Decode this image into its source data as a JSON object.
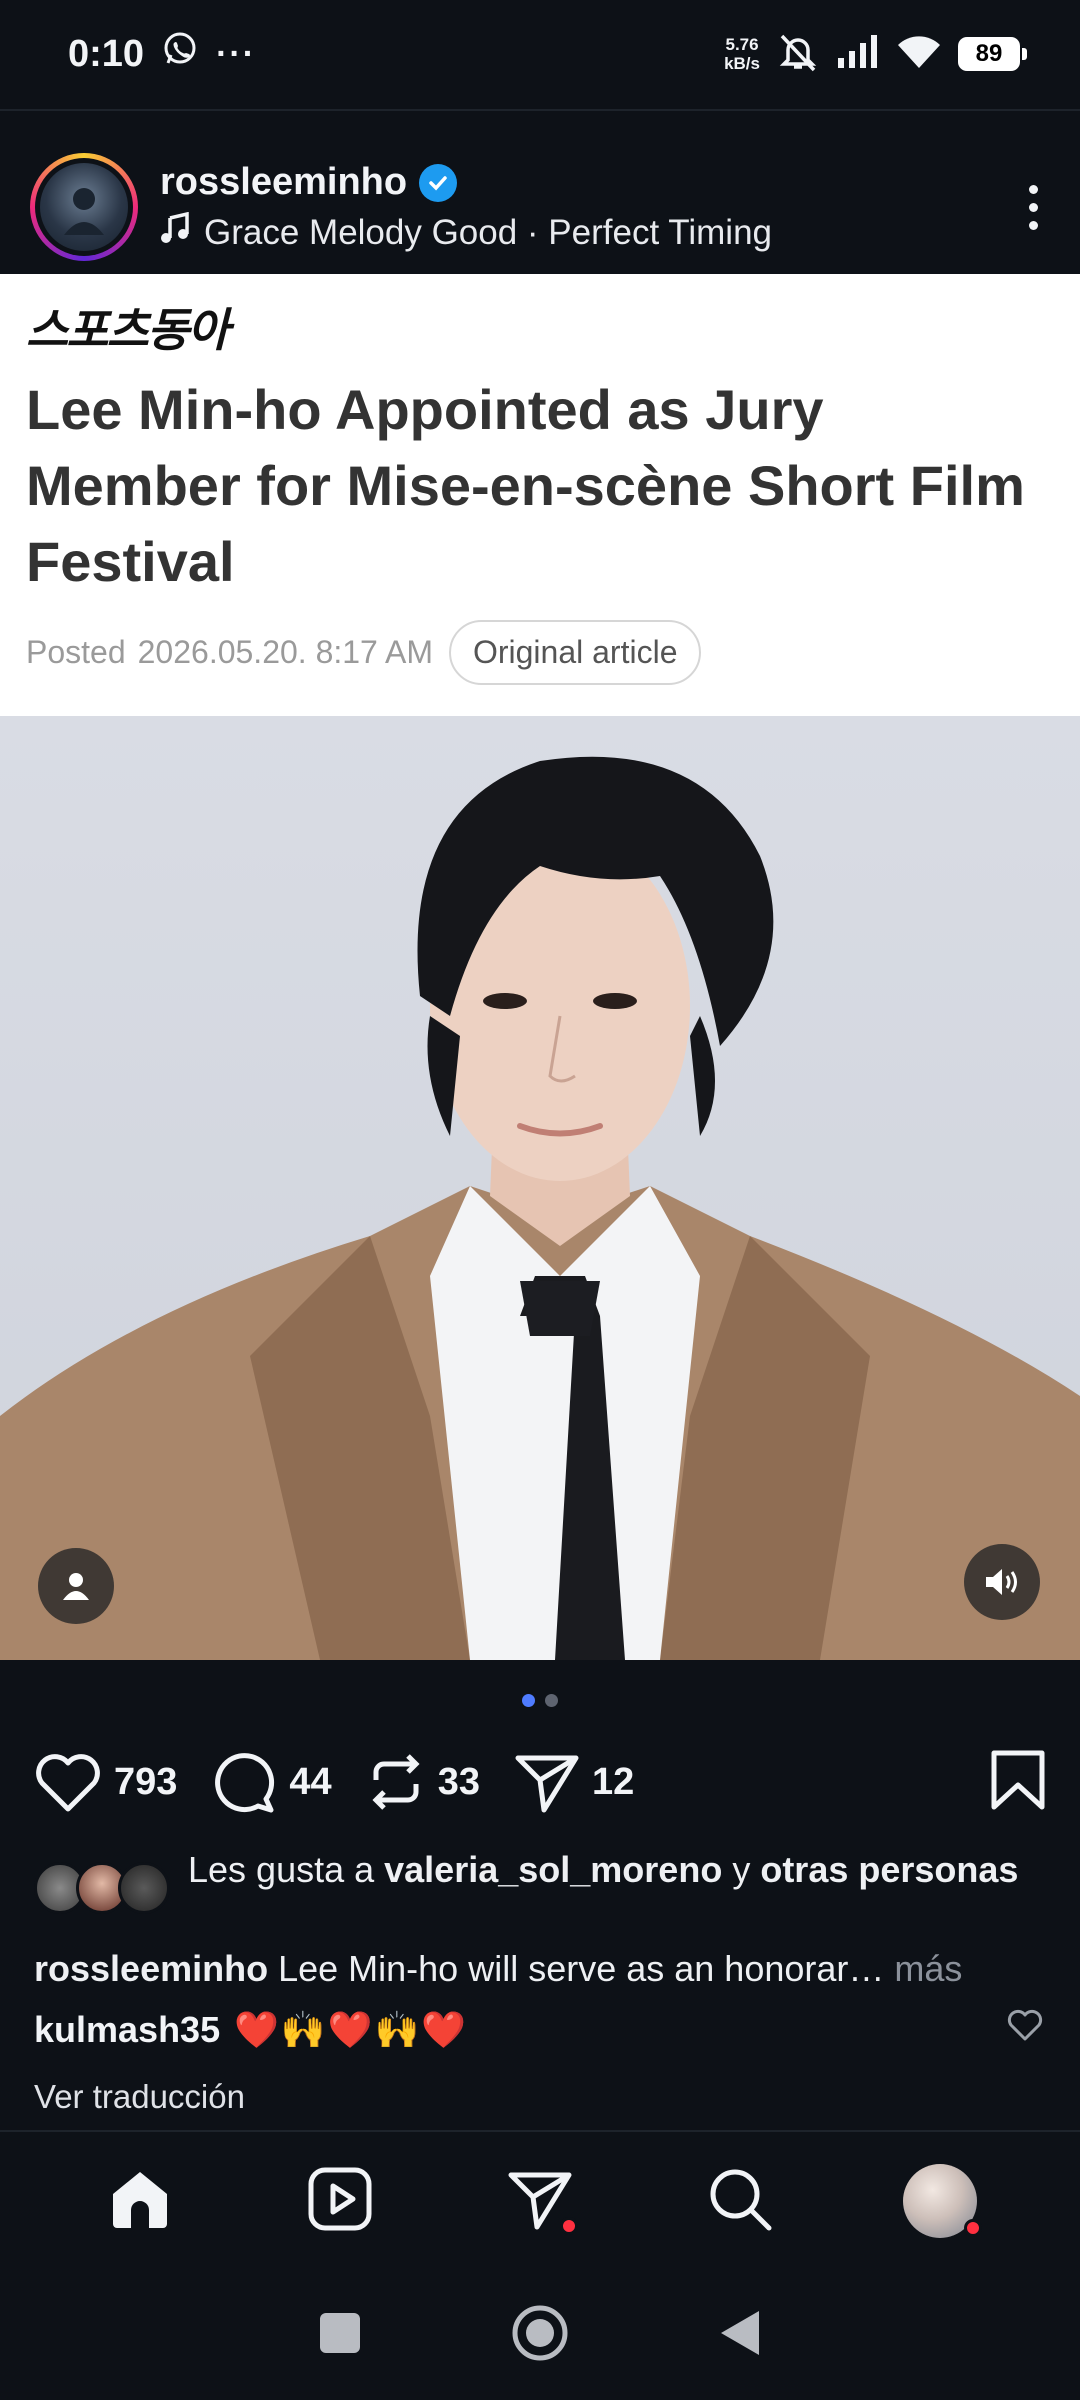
{
  "status_bar": {
    "time": "0:10",
    "extra": "···",
    "speed_value": "5.76",
    "speed_unit": "kB/s",
    "battery": "89"
  },
  "post": {
    "username": "rossleeminho",
    "music": "Grace Melody Good · Perfect Timing"
  },
  "article": {
    "logo": "스포츠동아",
    "headline": "Lee Min-ho Appointed as Jury Member for Mise-en-scène Short Film Festival",
    "posted_label": "Posted",
    "posted_date": "2026.05.20. 8:17 AM",
    "original_button": "Original article"
  },
  "carousel": {
    "total": 2,
    "active": 1
  },
  "actions": {
    "likes": "793",
    "comments": "44",
    "reposts": "33",
    "shares": "12"
  },
  "liked_by": {
    "prefix": "Les gusta a ",
    "user": "valeria_sol_moreno",
    "middle": " y ",
    "others": "otras personas"
  },
  "caption": {
    "user": "rossleeminho",
    "text": "Lee Min-ho will serve as an honorar…",
    "more": " más"
  },
  "comment": {
    "user": "kulmash35",
    "text": "❤️🙌❤️🙌❤️"
  },
  "translate_label": "Ver traducción",
  "icons": {
    "home": "home-icon",
    "reels": "reels-icon",
    "messages": "direct-icon",
    "search": "search-icon",
    "profile": "profile-avatar"
  },
  "colors": {
    "background": "#0d1117",
    "verified": "#1d9bf0",
    "notification": "#ff3040",
    "carousel_active": "#4f7cff"
  }
}
